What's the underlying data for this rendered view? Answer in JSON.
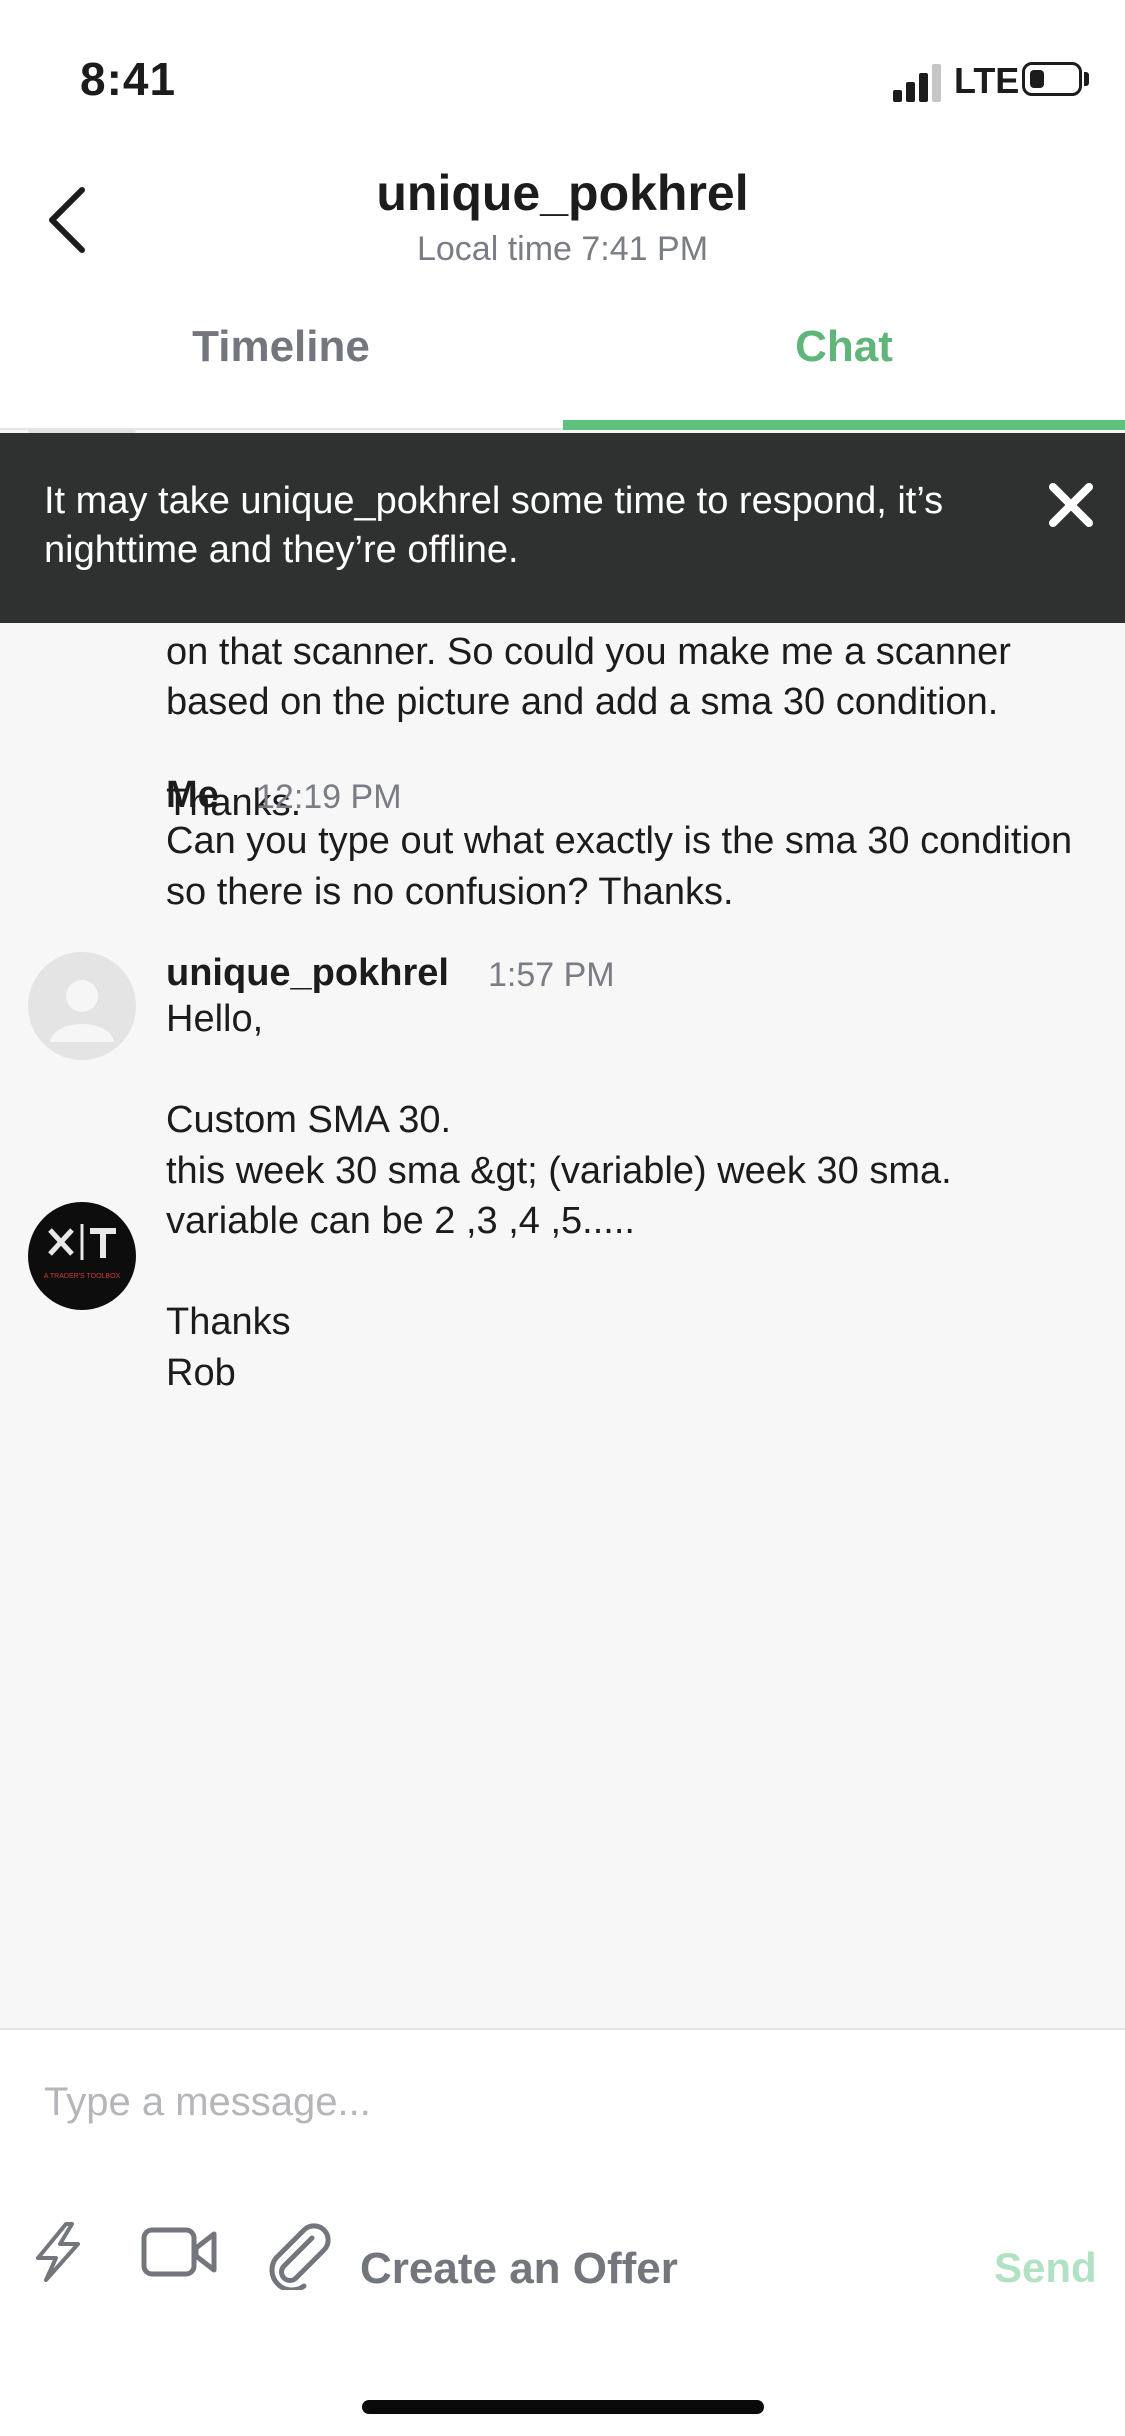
{
  "status_bar": {
    "time": "8:41",
    "network": "LTE"
  },
  "header": {
    "title": "unique_pokhrel",
    "subtitle": "Local time 7:41 PM",
    "tabs": [
      {
        "label": "Timeline",
        "active": false
      },
      {
        "label": "Chat",
        "active": true
      }
    ]
  },
  "banner": {
    "text": "It may take unique_pokhrel some time to respond, it’s nighttime and they’re offline."
  },
  "messages": [
    {
      "sender": "",
      "time": "",
      "text": "Hello,\n\nThank you for your Patience. to make things simple, I send you the pictures yesterday that is my main volume based scanner. I want a scanner that is based on that scanner. So could you make me a scanner based on the picture and add a sma 30 condition.\n\nThanks."
    },
    {
      "sender": "Me",
      "time": "12:19 PM",
      "text": "Can you type out what exactly is the sma 30 condition so there is no confusion? Thanks.",
      "avatar_logo_text": "A TRADER'S TOOLBOX"
    },
    {
      "sender": "unique_pokhrel",
      "time": "1:57 PM",
      "text": "Hello,\n\nCustom SMA 30.\nthis week 30 sma &gt; (variable) week 30 sma.\nvariable can be 2 ,3 ,4 ,5.....\n\nThanks\nRob"
    }
  ],
  "composer": {
    "placeholder": "Type a message...",
    "create_offer_label": "Create an Offer",
    "send_label": "Send"
  },
  "colors": {
    "accent": "#5ec27e",
    "banner_bg": "#2f3030",
    "chat_bg": "#f7f7f7",
    "send_disabled": "#b0e2c3"
  },
  "icons": [
    "back-chevron-icon",
    "close-icon",
    "lightning-icon",
    "video-camera-icon",
    "paperclip-icon"
  ]
}
